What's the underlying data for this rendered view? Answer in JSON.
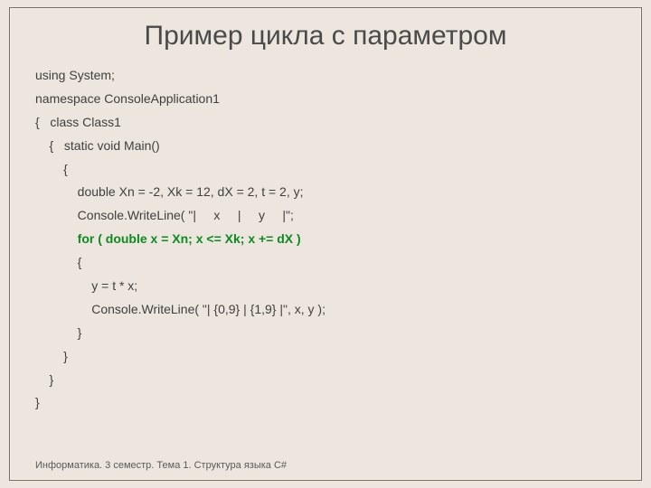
{
  "title": "Пример цикла с параметром",
  "code": {
    "l1": "using System;",
    "l2": "namespace ConsoleApplication1",
    "l3": "{   class Class1",
    "l4": "    {   static void Main()",
    "l5": "        {",
    "l6": "            double Xn = -2, Xk = 12, dX = 2, t = 2, y;",
    "l7": "            Console.WriteLine( \"|     x     |     y     |\";",
    "l8": "            for ( double x = Xn; x <= Xk; x += dX )",
    "l9": "            {",
    "l10": "                y = t * x;",
    "l11": "                Console.WriteLine( \"| {0,9} | {1,9} |\", x, y );",
    "l12": "            }",
    "l13": "        }",
    "l14": "    }",
    "l15": "}"
  },
  "footer": "Информатика. 3 семестр. Тема 1. Структура языка C#"
}
